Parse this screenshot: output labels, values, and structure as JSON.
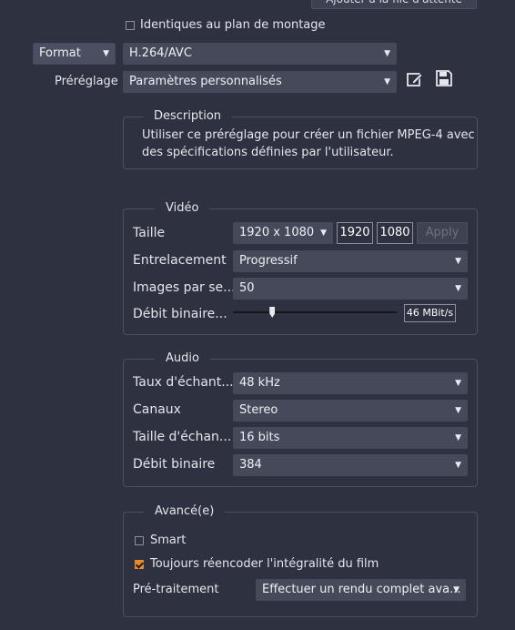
{
  "top_button_label": "Ajouter à la file d'attente",
  "same_as_timeline": {
    "label": "Identiques au plan de montage",
    "checked": false
  },
  "format": {
    "label": "Format",
    "codec": "H.264/AVC"
  },
  "preset": {
    "label": "Préréglage",
    "value": "Paramètres personnalisés",
    "edit_icon": "edit-icon",
    "save_icon": "save-icon"
  },
  "description": {
    "legend": "Description",
    "text_line1": "Utiliser ce préréglage pour créer un fichier MPEG-4 avec",
    "text_line2": "des spécifications définies par l'utilisateur."
  },
  "video": {
    "legend": "Vidéo",
    "size_label": "Taille",
    "size_value": "1920 x 1080",
    "width": "1920",
    "height": "1080",
    "apply_label": "Apply",
    "interlace_label": "Entrelacement",
    "interlace_value": "Progressif",
    "fps_label": "Images par se...",
    "fps_value": "50",
    "bitrate_label": "Débit binaire...",
    "bitrate_value": "46 MBit/s",
    "bitrate_slider_fraction": 0.24
  },
  "audio": {
    "legend": "Audio",
    "samplerate_label": "Taux d'échant...",
    "samplerate_value": "48 kHz",
    "channels_label": "Canaux",
    "channels_value": "Stereo",
    "samplesize_label": "Taille d'échan...",
    "samplesize_value": "16 bits",
    "bitrate_label": "Débit binaire",
    "bitrate_value": "384"
  },
  "advanced": {
    "legend": "Avancé(e)",
    "smart_label": "Smart",
    "smart_checked": false,
    "reencode_label": "Toujours réencoder l'intégralité du film",
    "reencode_checked": true,
    "pretreatment_label": "Pré-traitement",
    "pretreatment_value": "Effectuer un rendu complet ava..."
  },
  "colors": {
    "background": "#2d3140",
    "control": "#444a5a",
    "accent": "#e8892c",
    "border": "#4a5062"
  }
}
